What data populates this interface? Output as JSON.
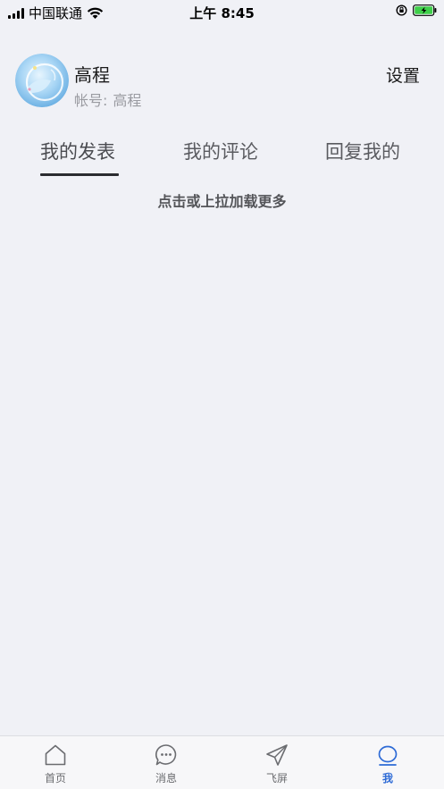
{
  "status_bar": {
    "carrier": "中国联通",
    "time": "上午 8:45"
  },
  "profile": {
    "name": "高程",
    "account_label": "帐号:",
    "account_value": "高程",
    "settings_label": "设置"
  },
  "tabs": [
    {
      "label": "我的发表",
      "active": true
    },
    {
      "label": "我的评论",
      "active": false
    },
    {
      "label": "回复我的",
      "active": false
    }
  ],
  "load_more": "点击或上拉加载更多",
  "tabbar": {
    "items": [
      {
        "label": "首页",
        "icon": "home-icon"
      },
      {
        "label": "消息",
        "icon": "message-icon"
      },
      {
        "label": "飞屏",
        "icon": "send-icon"
      },
      {
        "label": "我",
        "icon": "profile-icon",
        "active": true
      }
    ]
  },
  "colors": {
    "background": "#f0f1f6",
    "accent": "#2e6bd6",
    "battery": "#3fcf4a"
  }
}
